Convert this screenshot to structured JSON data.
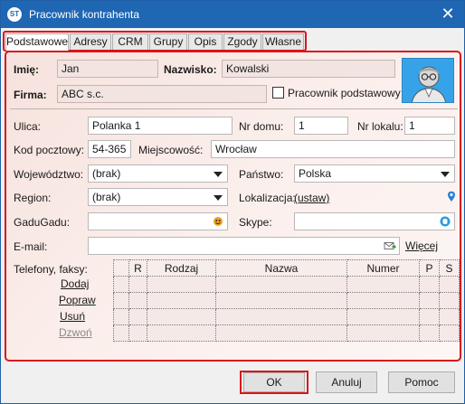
{
  "window": {
    "title": "Pracownik kontrahenta",
    "close_label": "✕"
  },
  "tabs": [
    "Podstawowe",
    "Adresy",
    "CRM",
    "Grupy",
    "Opis",
    "Zgody",
    "Własne"
  ],
  "person": {
    "first_name_label": "Imię:",
    "first_name": "Jan",
    "last_name_label": "Nazwisko:",
    "last_name": "Kowalski",
    "company_label": "Firma:",
    "company": "ABC s.c.",
    "primary_label": "Pracownik podstawowy",
    "primary_checked": false
  },
  "address": {
    "street_label": "Ulica:",
    "street": "Polanka 1",
    "house_no_label": "Nr domu:",
    "house_no": "1",
    "apt_no_label": "Nr lokalu:",
    "apt_no": "1",
    "postal_label": "Kod pocztowy:",
    "postal": "54-365",
    "city_label": "Miejscowość:",
    "city": "Wrocław",
    "province_label": "Województwo:",
    "province": "(brak)",
    "country_label": "Państwo:",
    "country": "Polska",
    "region_label": "Region:",
    "region": "(brak)",
    "location_label": "Lokalizacja:",
    "location_link": "(ustaw)"
  },
  "contact": {
    "gadugadu_label": "GaduGadu:",
    "gadugadu": "",
    "skype_label": "Skype:",
    "skype": "",
    "email_label": "E-mail:",
    "email": "",
    "email_link": "Więcej"
  },
  "phones": {
    "label": "Telefony, faksy:",
    "actions": [
      "Dodaj",
      "Popraw",
      "Usuń",
      "Dzwoń"
    ],
    "columns": [
      "R",
      "Rodzaj",
      "Nazwa",
      "Numer",
      "P",
      "S"
    ]
  },
  "buttons": {
    "ok": "OK",
    "cancel": "Anuluj",
    "help": "Pomoc"
  },
  "colors": {
    "titlebar": "#1f66b3",
    "highlight": "#d9151c",
    "photo_bg": "#36a3e8"
  }
}
